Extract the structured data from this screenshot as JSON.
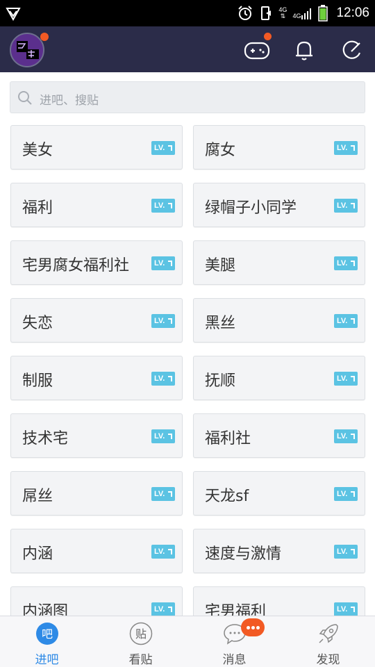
{
  "status_bar": {
    "time": "12:06",
    "network_top": "4G",
    "network_bottom": "4G"
  },
  "header": {},
  "search": {
    "placeholder": "进吧、搜贴"
  },
  "forums": [
    {
      "name": "美女",
      "level_label": "LV."
    },
    {
      "name": "腐女",
      "level_label": "LV."
    },
    {
      "name": "福利",
      "level_label": "LV."
    },
    {
      "name": "绿帽子小同学",
      "level_label": "LV."
    },
    {
      "name": "宅男腐女福利社",
      "level_label": "LV."
    },
    {
      "name": "美腿",
      "level_label": "LV."
    },
    {
      "name": "失恋",
      "level_label": "LV."
    },
    {
      "name": "黑丝",
      "level_label": "LV."
    },
    {
      "name": "制服",
      "level_label": "LV."
    },
    {
      "name": "抚顺",
      "level_label": "LV."
    },
    {
      "name": "技术宅",
      "level_label": "LV."
    },
    {
      "name": "福利社",
      "level_label": "LV."
    },
    {
      "name": "屌丝",
      "level_label": "LV."
    },
    {
      "name": "天龙sf",
      "level_label": "LV."
    },
    {
      "name": "内涵",
      "level_label": "LV."
    },
    {
      "name": "速度与激情",
      "level_label": "LV."
    },
    {
      "name": "内涵图",
      "level_label": "LV."
    },
    {
      "name": "宅男福利",
      "level_label": "LV."
    }
  ],
  "bottom_nav": [
    {
      "label": "进吧",
      "icon_text": "吧",
      "active": true
    },
    {
      "label": "看贴",
      "icon_text": "贴",
      "active": false
    },
    {
      "label": "消息",
      "icon_text": "",
      "active": false
    },
    {
      "label": "发现",
      "icon_text": "",
      "active": false
    }
  ],
  "colors": {
    "header_bg": "#2b2c49",
    "accent": "#2e8ae6",
    "badge": "#f25a24",
    "level_badge": "#5bc3e3"
  }
}
